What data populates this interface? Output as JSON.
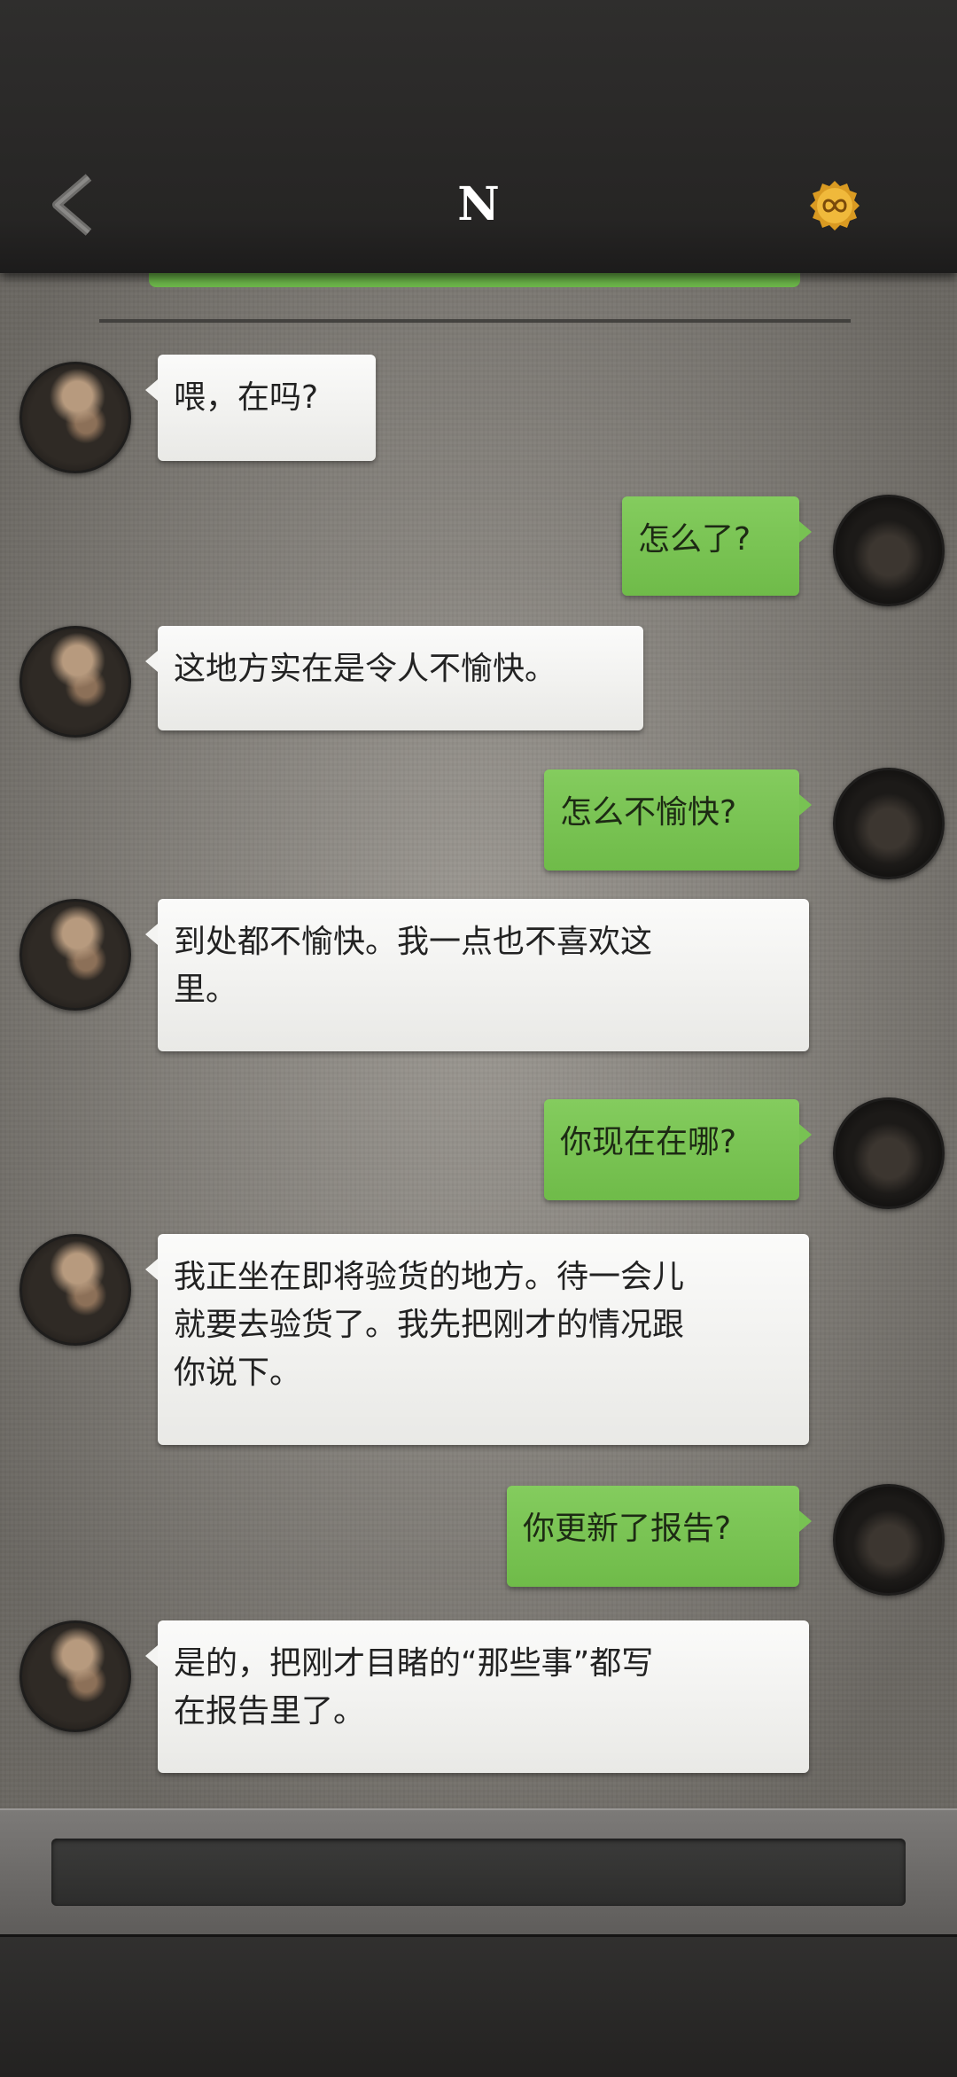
{
  "header": {
    "title": "N",
    "back_icon": "chevron-left-icon",
    "right_icon": "infinity-coin-icon",
    "colors": {
      "bar": "#262524",
      "coin": "#e0a62a"
    }
  },
  "colors": {
    "incoming_bubble": "#f2f2f0",
    "outgoing_bubble": "#78c253",
    "chat_background": "#8f8b84"
  },
  "messages": [
    {
      "side": "in",
      "text": "喂，在吗?"
    },
    {
      "side": "out",
      "text": "怎么了?"
    },
    {
      "side": "in",
      "text": "这地方实在是令人不愉快。"
    },
    {
      "side": "out",
      "text": "怎么不愉快?"
    },
    {
      "side": "in",
      "text": "到处都不愉快。我一点也不喜欢这\n里。"
    },
    {
      "side": "out",
      "text": "你现在在哪?"
    },
    {
      "side": "in",
      "text": "我正坐在即将验货的地方。待一会儿\n就要去验货了。我先把刚才的情况跟\n你说下。"
    },
    {
      "side": "out",
      "text": "你更新了报告?"
    },
    {
      "side": "in",
      "text": "是的，把刚才目睹的“那些事”都写\n在报告里了。"
    }
  ],
  "composer": {
    "placeholder": ""
  }
}
